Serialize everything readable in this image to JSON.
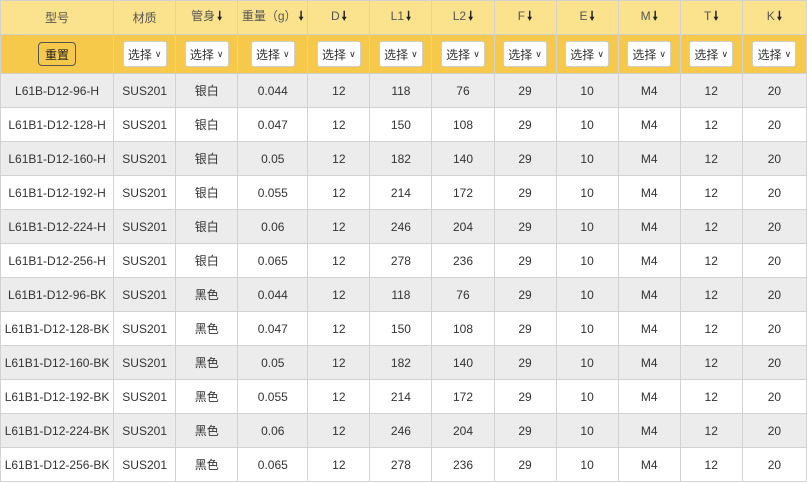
{
  "columns": [
    {
      "label": "型号",
      "sortable": false
    },
    {
      "label": "材质",
      "sortable": false
    },
    {
      "label": "管身",
      "sortable": true
    },
    {
      "label": "重量（g）",
      "sortable": true
    },
    {
      "label": "D",
      "sortable": true
    },
    {
      "label": "L1",
      "sortable": true
    },
    {
      "label": "L2",
      "sortable": true
    },
    {
      "label": "F",
      "sortable": true
    },
    {
      "label": "E",
      "sortable": true
    },
    {
      "label": "M",
      "sortable": true
    },
    {
      "label": "T",
      "sortable": true
    },
    {
      "label": "K",
      "sortable": true
    }
  ],
  "sort_arrow": "🠗",
  "reset_label": "重置",
  "select_placeholder": "选择",
  "rows": [
    [
      "L61B-D12-96-H",
      "SUS201",
      "银白",
      "0.044",
      "12",
      "118",
      "76",
      "29",
      "10",
      "M4",
      "12",
      "20"
    ],
    [
      "L61B1-D12-128-H",
      "SUS201",
      "银白",
      "0.047",
      "12",
      "150",
      "108",
      "29",
      "10",
      "M4",
      "12",
      "20"
    ],
    [
      "L61B1-D12-160-H",
      "SUS201",
      "银白",
      "0.05",
      "12",
      "182",
      "140",
      "29",
      "10",
      "M4",
      "12",
      "20"
    ],
    [
      "L61B1-D12-192-H",
      "SUS201",
      "银白",
      "0.055",
      "12",
      "214",
      "172",
      "29",
      "10",
      "M4",
      "12",
      "20"
    ],
    [
      "L61B1-D12-224-H",
      "SUS201",
      "银白",
      "0.06",
      "12",
      "246",
      "204",
      "29",
      "10",
      "M4",
      "12",
      "20"
    ],
    [
      "L61B1-D12-256-H",
      "SUS201",
      "银白",
      "0.065",
      "12",
      "278",
      "236",
      "29",
      "10",
      "M4",
      "12",
      "20"
    ],
    [
      "L61B1-D12-96-BK",
      "SUS201",
      "黑色",
      "0.044",
      "12",
      "118",
      "76",
      "29",
      "10",
      "M4",
      "12",
      "20"
    ],
    [
      "L61B1-D12-128-BK",
      "SUS201",
      "黑色",
      "0.047",
      "12",
      "150",
      "108",
      "29",
      "10",
      "M4",
      "12",
      "20"
    ],
    [
      "L61B1-D12-160-BK",
      "SUS201",
      "黑色",
      "0.05",
      "12",
      "182",
      "140",
      "29",
      "10",
      "M4",
      "12",
      "20"
    ],
    [
      "L61B1-D12-192-BK",
      "SUS201",
      "黑色",
      "0.055",
      "12",
      "214",
      "172",
      "29",
      "10",
      "M4",
      "12",
      "20"
    ],
    [
      "L61B1-D12-224-BK",
      "SUS201",
      "黑色",
      "0.06",
      "12",
      "246",
      "204",
      "29",
      "10",
      "M4",
      "12",
      "20"
    ],
    [
      "L61B1-D12-256-BK",
      "SUS201",
      "黑色",
      "0.065",
      "12",
      "278",
      "236",
      "29",
      "10",
      "M4",
      "12",
      "20"
    ]
  ],
  "colors": {
    "header_bg": "#fbe28d",
    "filter_bg": "#f6c94a",
    "row_alt_bg": "#ececec",
    "border": "#d2d2d2"
  }
}
